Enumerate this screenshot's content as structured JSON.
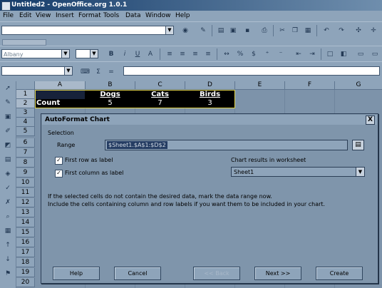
{
  "window": {
    "title": "Untitled2 - OpenOffice.org 1.0.1"
  },
  "menu": [
    "File",
    "Edit",
    "View",
    "Insert",
    "Format",
    "Tools",
    "Data",
    "Window",
    "Help"
  ],
  "toolbar": {
    "font_name": "Albany",
    "font_size": "",
    "name_box": "",
    "formula_input": ""
  },
  "sheet": {
    "columns": [
      "A",
      "B",
      "C",
      "D",
      "E",
      "F",
      "G"
    ],
    "rows": [
      "1",
      "2",
      "3",
      "4",
      "5",
      "6",
      "7",
      "8",
      "9",
      "10",
      "11",
      "12",
      "13",
      "14",
      "15",
      "16",
      "17",
      "18",
      "19",
      "20"
    ],
    "row1": [
      "",
      "Dogs",
      "Cats",
      "Birds"
    ],
    "row2": [
      "Count",
      "5",
      "7",
      "3"
    ]
  },
  "dialog": {
    "title": "AutoFormat Chart",
    "close_label": "X",
    "selection_label": "Selection",
    "range_label": "Range",
    "range_value": "$Sheet1.$A$1:$D$2",
    "first_row_label": "First row as label",
    "first_column_label": "First column as label",
    "results_label": "Chart results in worksheet",
    "results_value": "Sheet1",
    "info_line1": "If the selected cells do not contain the desired data, mark the data range now.",
    "info_line2": "Include the cells containing column and row labels if you want them to be included in your chart.",
    "buttons": {
      "help": "Help",
      "cancel": "Cancel",
      "back": "<< Back",
      "next": "Next >>",
      "create": "Create"
    }
  }
}
